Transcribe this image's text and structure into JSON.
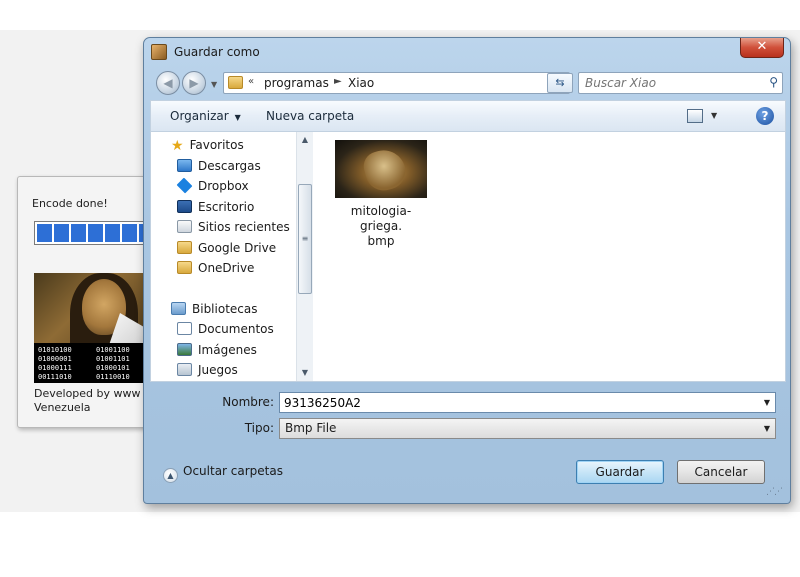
{
  "background_app": {
    "status": "Encode done!",
    "progress_fraction": 0.85,
    "binary_left": [
      "01010100",
      "01000001",
      "01000111",
      "00111010"
    ],
    "binary_right": [
      "01001100",
      "01001101",
      "01000101",
      "01110010"
    ],
    "developer_line1": "Developed by www",
    "developer_line2": "Venezuela"
  },
  "dialog": {
    "title": "Guardar como",
    "close_glyph": "✕",
    "icons": {
      "back": "back-arrow-icon",
      "forward": "forward-arrow-icon",
      "refresh": "refresh-icon",
      "search": "search-icon",
      "help": "help-icon"
    },
    "breadcrumb": {
      "separator": "«",
      "items": [
        "programas",
        "Xiao"
      ],
      "arrow": "►"
    },
    "search_placeholder": "Buscar Xiao",
    "toolbar": {
      "organize": "Organizar",
      "new_folder": "Nueva carpeta",
      "help_glyph": "?"
    },
    "nav": {
      "favorites": "Favoritos",
      "favorites_items": [
        "Descargas",
        "Dropbox",
        "Escritorio",
        "Sitios recientes",
        "Google Drive",
        "OneDrive"
      ],
      "libraries": "Bibliotecas",
      "library_items": [
        "Documentos",
        "Imágenes",
        "Juegos"
      ]
    },
    "files": [
      {
        "name_line1": "mitologia-griega.",
        "name_line2": "bmp"
      }
    ],
    "filename_label": "Nombre:",
    "filename_value": "93136250A2",
    "filetype_label": "Tipo:",
    "filetype_value": "Bmp File",
    "hide_folders": "Ocultar carpetas",
    "save_button": "Guardar",
    "cancel_button": "Cancelar"
  }
}
